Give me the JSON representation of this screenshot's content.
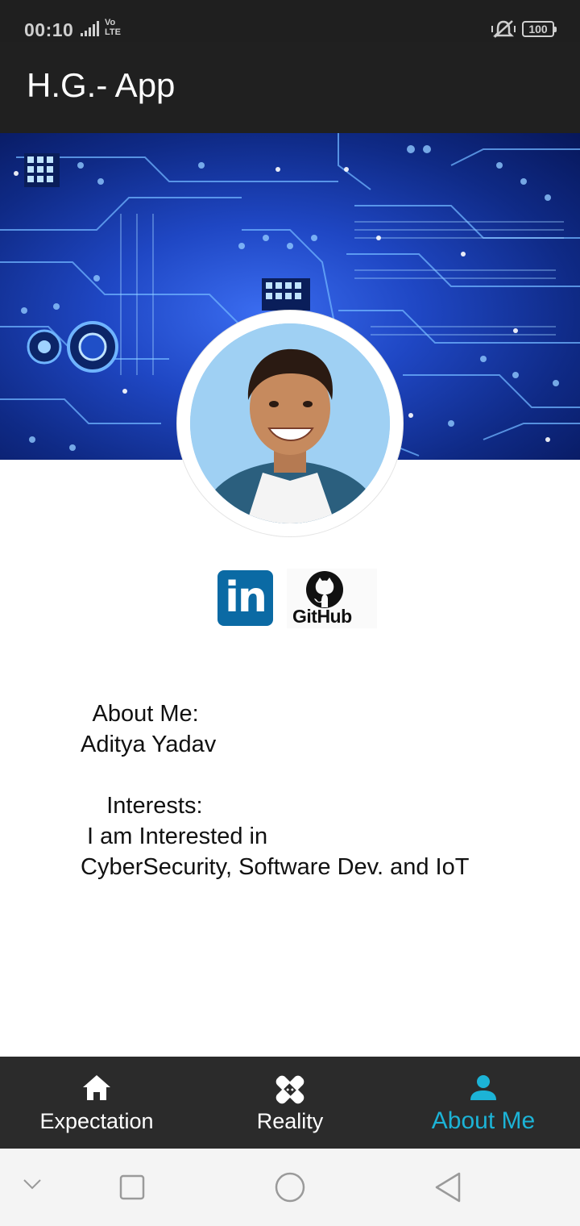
{
  "status_bar": {
    "time": "00:10",
    "network": "Vo\nLTE",
    "battery": "100"
  },
  "app_bar": {
    "title": "H.G.- App"
  },
  "profile": {
    "linkedin_label": "in",
    "github_label": "GitHub",
    "about_text": "  About Me:\nAditya Yadav\n\n    Interests:\n I am Interested in\nCyberSecurity, Software Dev. and IoT"
  },
  "bottom_nav": {
    "items": [
      {
        "label": "Expectation",
        "icon": "home-icon"
      },
      {
        "label": "Reality",
        "icon": "bandage-icon"
      },
      {
        "label": "About Me",
        "icon": "person-icon",
        "active": true
      }
    ],
    "active_color": "#1cb3d6"
  },
  "system_nav": {
    "icons": [
      "chevron-down-icon",
      "square-icon",
      "circle-icon",
      "back-triangle-icon"
    ]
  }
}
